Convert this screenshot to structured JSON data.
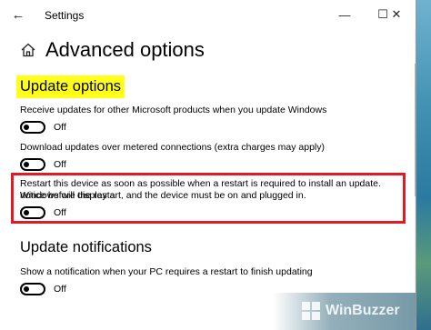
{
  "titlebar": {
    "app_title": "Settings",
    "back_glyph": "←",
    "minimize_glyph": "—",
    "maximize_glyph": "☐",
    "close_glyph": "✕"
  },
  "page": {
    "title": "Advanced options"
  },
  "update_options": {
    "heading": "Update options",
    "settings": [
      {
        "label": "Receive updates for other Microsoft products when you update Windows",
        "state": "Off"
      },
      {
        "label": "Download updates over metered connections (extra charges may apply)",
        "state": "Off"
      },
      {
        "label_line1": "Restart this device as soon as possible when a restart is required to install an update. Windows will display a",
        "label_line2": "notice before the restart, and the device must be on and plugged in.",
        "state": "Off"
      }
    ]
  },
  "update_notifications": {
    "heading": "Update notifications",
    "settings": [
      {
        "label": "Show a notification when your PC requires a restart to finish updating",
        "state": "Off"
      }
    ]
  },
  "watermark": {
    "text": "WinBuzzer"
  },
  "colors": {
    "highlight": "#ffff1a",
    "annotation_box": "#e01b24"
  }
}
